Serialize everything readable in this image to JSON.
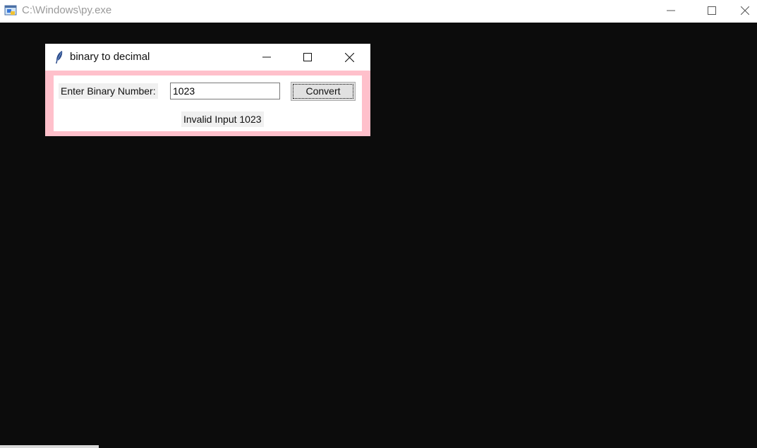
{
  "console": {
    "title": "C:\\Windows\\py.exe",
    "icon": "python-console-icon"
  },
  "app": {
    "title": "binary to decimal",
    "icon": "tk-feather-icon",
    "colors": {
      "body_background": "#ffc0cb",
      "frame_background": "#ffffff",
      "console_background": "#0c0c0c"
    },
    "input_label": "Enter Binary Number:",
    "input_value": "1023",
    "convert_label": "Convert",
    "result_text": "Invalid Input 1023"
  }
}
